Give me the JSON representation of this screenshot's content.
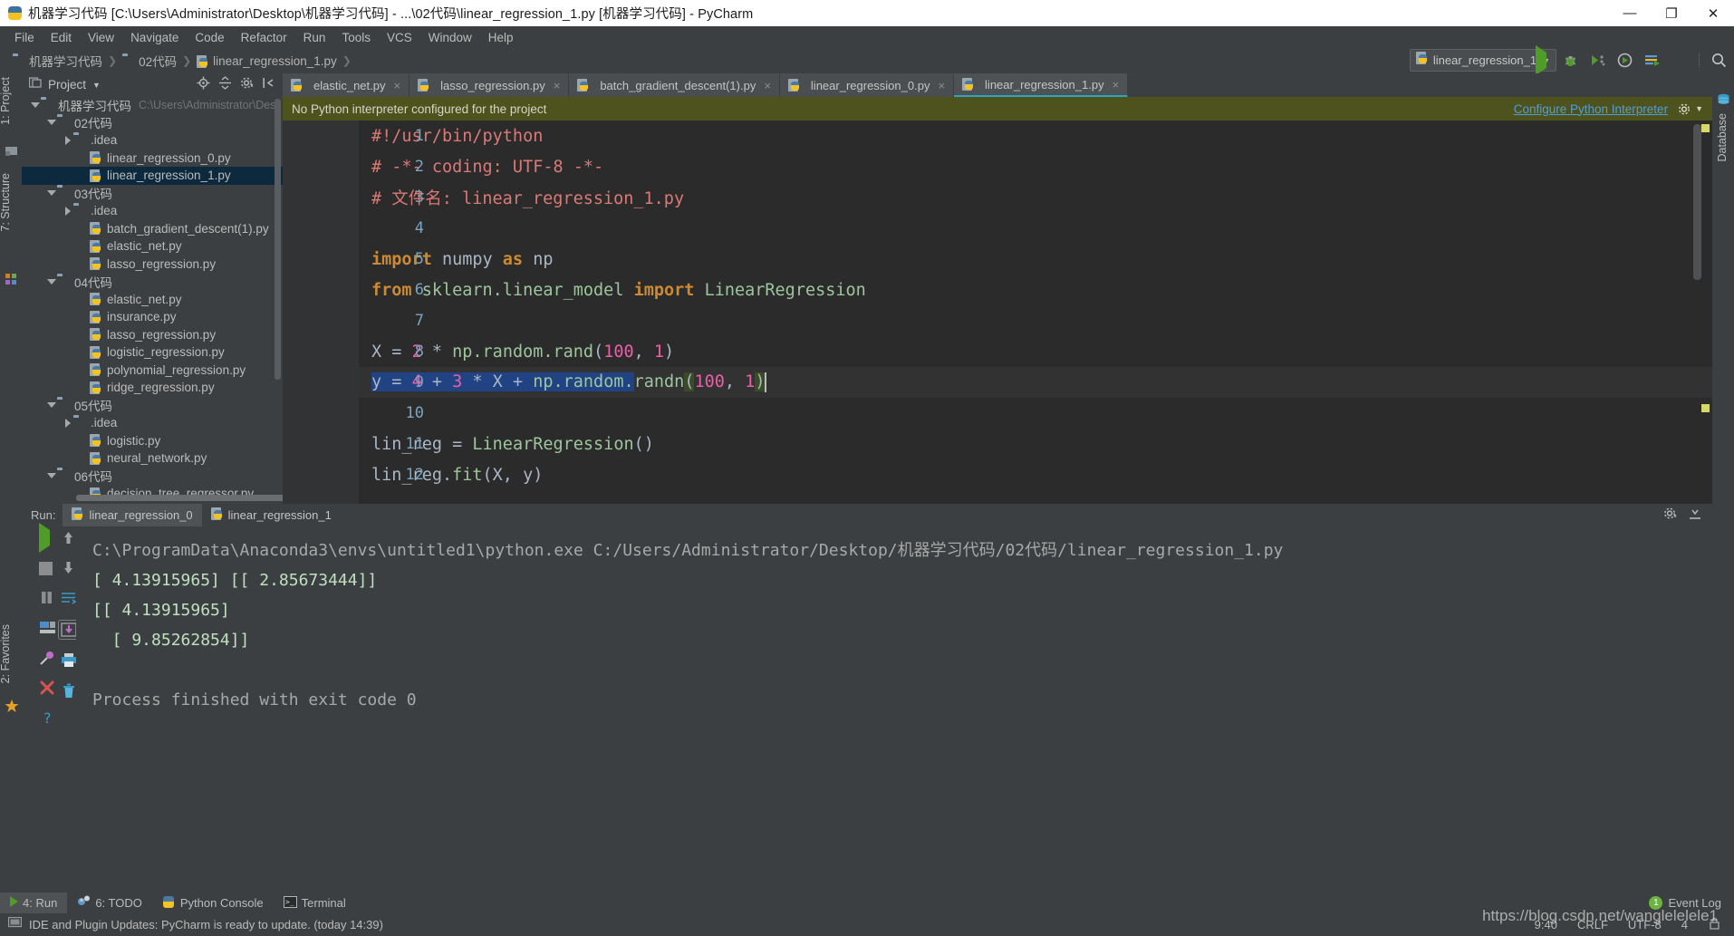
{
  "window": {
    "title": "机器学习代码 [C:\\Users\\Administrator\\Desktop\\机器学习代码] - ...\\02代码\\linear_regression_1.py [机器学习代码] - PyCharm",
    "minimize": "—",
    "maximize": "❐",
    "close": "✕"
  },
  "menu": [
    {
      "label": "File"
    },
    {
      "label": "Edit"
    },
    {
      "label": "View"
    },
    {
      "label": "Navigate"
    },
    {
      "label": "Code"
    },
    {
      "label": "Refactor"
    },
    {
      "label": "Run"
    },
    {
      "label": "Tools"
    },
    {
      "label": "VCS"
    },
    {
      "label": "Window"
    },
    {
      "label": "Help"
    }
  ],
  "breadcrumb": [
    {
      "label": "机器学习代码",
      "icon": "folder-icon"
    },
    {
      "label": "02代码",
      "icon": "folder-icon"
    },
    {
      "label": "linear_regression_1.py",
      "icon": "python-file-icon"
    }
  ],
  "run_config": {
    "name": "linear_regression_1",
    "caret": "▼",
    "buttons": [
      "run-icon",
      "debug-icon",
      "coverage-icon",
      "profile-icon",
      "edit-config-icon",
      "stop-icon",
      "search-icon"
    ]
  },
  "left_strip": [
    {
      "label": "1: Project",
      "key": "1"
    },
    {
      "label": "7: Structure",
      "key": "7"
    },
    {
      "label": "2: Favorites",
      "key": "2"
    }
  ],
  "right_strip": [
    {
      "label": "Database"
    }
  ],
  "project_panel": {
    "title": "Project",
    "caret": "▼",
    "actions": [
      "locate-icon",
      "collapse-all-icon",
      "settings-icon",
      "hide-icon"
    ],
    "tree": [
      {
        "depth": 0,
        "twisty": "down",
        "icon": "folder-icon",
        "label": "机器学习代码",
        "path": "C:\\Users\\Administrator\\Des",
        "selected": false
      },
      {
        "depth": 1,
        "twisty": "down",
        "icon": "folder-icon",
        "label": "02代码",
        "path": "",
        "selected": false
      },
      {
        "depth": 2,
        "twisty": "right",
        "icon": "folder-icon",
        "label": ".idea",
        "path": "",
        "selected": false
      },
      {
        "depth": 3,
        "twisty": "none",
        "icon": "python-file-icon",
        "label": "linear_regression_0.py",
        "path": "",
        "selected": false
      },
      {
        "depth": 3,
        "twisty": "none",
        "icon": "python-file-icon",
        "label": "linear_regression_1.py",
        "path": "",
        "selected": true
      },
      {
        "depth": 1,
        "twisty": "down",
        "icon": "folder-icon",
        "label": "03代码",
        "path": "",
        "selected": false
      },
      {
        "depth": 2,
        "twisty": "right",
        "icon": "folder-icon",
        "label": ".idea",
        "path": "",
        "selected": false
      },
      {
        "depth": 3,
        "twisty": "none",
        "icon": "python-file-icon",
        "label": "batch_gradient_descent(1).py",
        "path": "",
        "selected": false
      },
      {
        "depth": 3,
        "twisty": "none",
        "icon": "python-file-icon",
        "label": "elastic_net.py",
        "path": "",
        "selected": false
      },
      {
        "depth": 3,
        "twisty": "none",
        "icon": "python-file-icon",
        "label": "lasso_regression.py",
        "path": "",
        "selected": false
      },
      {
        "depth": 1,
        "twisty": "down",
        "icon": "folder-icon",
        "label": "04代码",
        "path": "",
        "selected": false
      },
      {
        "depth": 3,
        "twisty": "none",
        "icon": "python-file-icon",
        "label": "elastic_net.py",
        "path": "",
        "selected": false
      },
      {
        "depth": 3,
        "twisty": "none",
        "icon": "python-file-icon",
        "label": "insurance.py",
        "path": "",
        "selected": false
      },
      {
        "depth": 3,
        "twisty": "none",
        "icon": "python-file-icon",
        "label": "lasso_regression.py",
        "path": "",
        "selected": false
      },
      {
        "depth": 3,
        "twisty": "none",
        "icon": "python-file-icon",
        "label": "logistic_regression.py",
        "path": "",
        "selected": false
      },
      {
        "depth": 3,
        "twisty": "none",
        "icon": "python-file-icon",
        "label": "polynomial_regression.py",
        "path": "",
        "selected": false
      },
      {
        "depth": 3,
        "twisty": "none",
        "icon": "python-file-icon",
        "label": "ridge_regression.py",
        "path": "",
        "selected": false
      },
      {
        "depth": 1,
        "twisty": "down",
        "icon": "folder-icon",
        "label": "05代码",
        "path": "",
        "selected": false
      },
      {
        "depth": 2,
        "twisty": "right",
        "icon": "folder-icon",
        "label": ".idea",
        "path": "",
        "selected": false
      },
      {
        "depth": 3,
        "twisty": "none",
        "icon": "python-file-icon",
        "label": "logistic.py",
        "path": "",
        "selected": false
      },
      {
        "depth": 3,
        "twisty": "none",
        "icon": "python-file-icon",
        "label": "neural_network.py",
        "path": "",
        "selected": false
      },
      {
        "depth": 1,
        "twisty": "down",
        "icon": "folder-icon",
        "label": "06代码",
        "path": "",
        "selected": false
      },
      {
        "depth": 3,
        "twisty": "none",
        "icon": "python-file-icon",
        "label": "decision_tree_regressor.py",
        "path": "",
        "selected": false
      }
    ]
  },
  "editor_tabs": [
    {
      "label": "elastic_net.py",
      "active": false,
      "close": "×"
    },
    {
      "label": "lasso_regression.py",
      "active": false,
      "close": "×"
    },
    {
      "label": "batch_gradient_descent(1).py",
      "active": false,
      "close": "×"
    },
    {
      "label": "linear_regression_0.py",
      "active": false,
      "close": "×"
    },
    {
      "label": "linear_regression_1.py",
      "active": true,
      "close": "×"
    }
  ],
  "warning_bar": {
    "message": "No Python interpreter configured for the project",
    "link": "Configure Python Interpreter",
    "gear": "gear-icon"
  },
  "editor": {
    "lines": [
      {
        "num": "1",
        "current": false,
        "tokens": [
          {
            "t": "#!/usr/bin/python",
            "c": "c-comment"
          }
        ]
      },
      {
        "num": "2",
        "current": false,
        "tokens": [
          {
            "t": "# -*- coding: UTF-8 -*-",
            "c": "c-comment"
          }
        ]
      },
      {
        "num": "3",
        "current": false,
        "tokens": [
          {
            "t": "# 文件名: linear_regression_1.py",
            "c": "c-comment"
          }
        ]
      },
      {
        "num": "4",
        "current": false,
        "tokens": []
      },
      {
        "num": "5",
        "current": false,
        "tokens": [
          {
            "t": "import",
            "c": "c-kw"
          },
          {
            "t": " numpy ",
            "c": "c-id"
          },
          {
            "t": "as",
            "c": "c-kw"
          },
          {
            "t": " np",
            "c": "c-id"
          }
        ]
      },
      {
        "num": "6",
        "current": false,
        "tokens": [
          {
            "t": "from",
            "c": "c-kw"
          },
          {
            "t": " sklearn.linear_model ",
            "c": "c-mod"
          },
          {
            "t": "import",
            "c": "c-kw"
          },
          {
            "t": " LinearRegression",
            "c": "c-cls"
          }
        ]
      },
      {
        "num": "7",
        "current": false,
        "tokens": []
      },
      {
        "num": "8",
        "current": false,
        "tokens": [
          {
            "t": "X = ",
            "c": "c-id"
          },
          {
            "t": "2",
            "c": "c-num"
          },
          {
            "t": " * ",
            "c": "c-id"
          },
          {
            "t": "np.random.rand",
            "c": "c-mod"
          },
          {
            "t": "(",
            "c": "c-id"
          },
          {
            "t": "100",
            "c": "c-num"
          },
          {
            "t": ", ",
            "c": "c-id"
          },
          {
            "t": "1",
            "c": "c-num"
          },
          {
            "t": ")",
            "c": "c-id"
          }
        ]
      },
      {
        "num": "9",
        "current": true,
        "tokens": [
          {
            "t": "y = ",
            "c": "c-id sel-hl"
          },
          {
            "t": "4",
            "c": "c-num sel-hl"
          },
          {
            "t": " + ",
            "c": "c-id sel-hl"
          },
          {
            "t": "3",
            "c": "c-num sel-hl"
          },
          {
            "t": " * X + ",
            "c": "c-id sel-hl"
          },
          {
            "t": "np.random.",
            "c": "c-mod sel-hl"
          },
          {
            "t": "randn",
            "c": "c-mod"
          },
          {
            "t": "(",
            "c": "c-id brk-hl"
          },
          {
            "t": "100",
            "c": "c-num"
          },
          {
            "t": ", ",
            "c": "c-id"
          },
          {
            "t": "1",
            "c": "c-num"
          },
          {
            "t": ")",
            "c": "c-id brk-hl"
          }
        ]
      },
      {
        "num": "10",
        "current": false,
        "tokens": []
      },
      {
        "num": "11",
        "current": false,
        "tokens": [
          {
            "t": "lin_reg = ",
            "c": "c-id"
          },
          {
            "t": "LinearRegression",
            "c": "c-cls"
          },
          {
            "t": "()",
            "c": "c-id"
          }
        ]
      },
      {
        "num": "12",
        "current": false,
        "tokens": [
          {
            "t": "lin_reg.",
            "c": "c-id"
          },
          {
            "t": "fit",
            "c": "c-fn"
          },
          {
            "t": "(X, y)",
            "c": "c-id"
          }
        ]
      }
    ]
  },
  "run_panel": {
    "label": "Run:",
    "tabs": [
      {
        "label": "linear_regression_0",
        "active": true
      },
      {
        "label": "linear_regression_1",
        "active": false
      }
    ],
    "header_actions": [
      "settings-icon",
      "hide-icon"
    ],
    "tools_left": [
      "rerun-icon",
      "stop-icon",
      "pause-icon",
      "console-icon",
      "pin-icon",
      "close-icon",
      "help-icon"
    ],
    "tools_right": [
      "up-icon",
      "down-icon",
      "soft-wrap-icon",
      "scroll-to-end-icon",
      "print-icon",
      "trash-icon"
    ],
    "console_lines": [
      {
        "text": "C:\\ProgramData\\Anaconda3\\envs\\untitled1\\python.exe C:/Users/Administrator/Desktop/机器学习代码/02代码/linear_regression_1.py",
        "kind": "cmd"
      },
      {
        "text": "[ 4.13915965] [[ 2.85673444]]",
        "kind": "val"
      },
      {
        "text": "[[ 4.13915965]",
        "kind": "val"
      },
      {
        "text": "  [ 9.85262854]]",
        "kind": "val"
      },
      {
        "text": "",
        "kind": "val"
      },
      {
        "text": "Process finished with exit code 0",
        "kind": "cmd"
      }
    ]
  },
  "toolwindow_bar": {
    "items": [
      {
        "label": "4: Run",
        "key": "4",
        "active": true,
        "icon": "run-icon"
      },
      {
        "label": "6: TODO",
        "key": "6",
        "active": false,
        "icon": "todo-icon"
      },
      {
        "label": "Python Console",
        "key": "",
        "active": false,
        "icon": "python-icon"
      },
      {
        "label": "Terminal",
        "key": "",
        "active": false,
        "icon": "terminal-icon"
      }
    ],
    "event_log": {
      "label": "Event Log",
      "count": "1"
    }
  },
  "status_bar": {
    "message": "IDE and Plugin Updates: PyCharm is ready to update. (today 14:39)",
    "position": "9:40",
    "line_sep": "CRLF",
    "encoding": "UTF-8",
    "indent": "4",
    "lock": "lock-icon"
  },
  "watermark": "https://blog.csdn.net/wanglelelele1",
  "colors": {
    "accent": "#2aa5c4",
    "warning_bg": "#4e521c",
    "link": "#549dd4",
    "selection": "#214283",
    "tree_selected": "#0d293e",
    "comment": "#d97a76",
    "keyword": "#cc8a34",
    "number": "#ea5fa8",
    "string": "#9dc69d"
  }
}
